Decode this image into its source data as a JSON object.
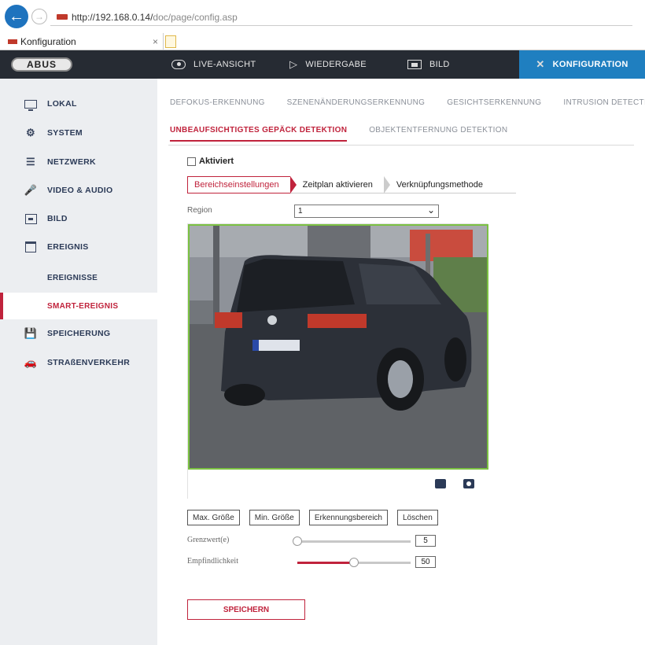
{
  "browser": {
    "url_host": "http://192.168.0.14/",
    "url_path": "doc/page/config.asp",
    "tab_title": "Konfiguration",
    "tab_close": "×"
  },
  "topnav": {
    "logo": "ABUS",
    "items": [
      {
        "label": "LIVE-ANSICHT",
        "icon": "eye-icon"
      },
      {
        "label": "WIEDERGABE",
        "icon": "play-icon"
      },
      {
        "label": "BILD",
        "icon": "image-icon"
      },
      {
        "label": "KONFIGURATION",
        "icon": "tools-icon",
        "active": true
      }
    ]
  },
  "sidebar": {
    "items": [
      {
        "label": "LOKAL",
        "icon": "monitor-icon"
      },
      {
        "label": "SYSTEM",
        "icon": "gear-icon"
      },
      {
        "label": "NETZWERK",
        "icon": "network-icon"
      },
      {
        "label": "VIDEO & AUDIO",
        "icon": "microphone-icon"
      },
      {
        "label": "BILD",
        "icon": "image-icon"
      },
      {
        "label": "EREIGNIS",
        "icon": "calendar-icon"
      },
      {
        "label": "SPEICHERUNG",
        "icon": "disk-icon"
      },
      {
        "label": "STRAßENVERKEHR",
        "icon": "traffic-icon"
      }
    ],
    "subitems": [
      {
        "label": "EREIGNISSE"
      },
      {
        "label": "SMART-EREIGNIS",
        "active": true
      }
    ]
  },
  "subtabs": {
    "row1": [
      "DEFOKUS-ERKENNUNG",
      "SZENENÄNDERUNGSERKENNUNG",
      "GESICHTSERKENNUNG",
      "INTRUSION DETECTION"
    ],
    "row2": [
      "UNBEAUFSICHTIGTES GEPÄCK DETEKTION",
      "OBJEKTENTFERNUNG DETEKTION"
    ],
    "active": "UNBEAUFSICHTIGTES GEPÄCK DETEKTION"
  },
  "enabled_label": "Aktiviert",
  "steps": [
    "Bereichseinstellungen",
    "Zeitplan aktivieren",
    "Verknüpfungsmethode"
  ],
  "region": {
    "label": "Region",
    "value": "1"
  },
  "buttons": [
    "Max. Größe",
    "Min. Größe",
    "Erkennungsbereich",
    "Löschen"
  ],
  "threshold": {
    "label": "Grenzwert(e)",
    "value": "5",
    "level": 0
  },
  "sensitivity": {
    "label": "Empfindlichkeit",
    "value": "50",
    "level": 0.5
  },
  "save_label": "SPEICHERN",
  "colors": {
    "accent": "#c0233c",
    "nav_active": "#1f7fc0",
    "video_border": "#7bc142"
  }
}
